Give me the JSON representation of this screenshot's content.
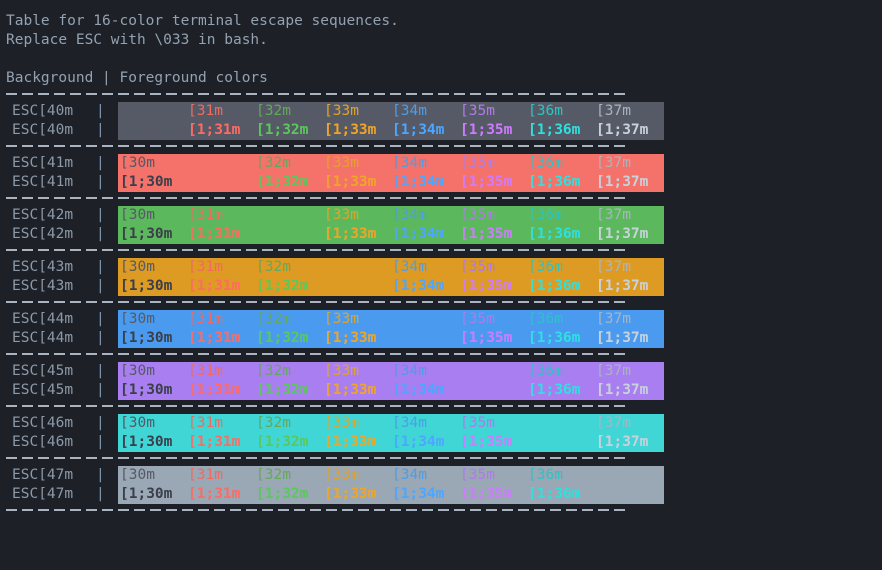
{
  "terminal": {
    "background_color": "#1d2127",
    "default_text_color": "#93a1b0",
    "separator_color": "#aab4c0",
    "pipe_color": "#7f93ad"
  },
  "header": {
    "line1": "Table for 16-color terminal escape sequences.",
    "line2": "Replace ESC with \\033 in bash.",
    "section_title": "Background | Foreground colors",
    "pipe": "|"
  },
  "foreground_codes": {
    "normal": [
      "[30m",
      "[31m",
      "[32m",
      "[33m",
      "[34m",
      "[35m",
      "[36m",
      "[37m"
    ],
    "bold": [
      "[1;30m",
      "[1;31m",
      "[1;32m",
      "[1;33m",
      "[1;34m",
      "[1;35m",
      "[1;36m",
      "[1;37m"
    ]
  },
  "foreground_colors": {
    "normal": [
      "#555a66",
      "#f06a60",
      "#64a85a",
      "#e0a32a",
      "#4d9de8",
      "#b07ae8",
      "#2dc3c3",
      "#a9b4c0"
    ],
    "bold": [
      "#3a3f4a",
      "#ff6b63",
      "#5bc85b",
      "#f0a526",
      "#4da6ff",
      "#cf7bff",
      "#2ee0e0",
      "#c8d2dc"
    ]
  },
  "rows": [
    {
      "label": "ESC[40m",
      "bg_code": "40",
      "bg_name": "black",
      "bg_color": "#555a66",
      "hidden_index": 0
    },
    {
      "label": "ESC[41m",
      "bg_code": "41",
      "bg_name": "red",
      "bg_color": "#f4726a",
      "hidden_index": 1
    },
    {
      "label": "ESC[42m",
      "bg_code": "42",
      "bg_name": "green",
      "bg_color": "#5cb85c",
      "hidden_index": 2
    },
    {
      "label": "ESC[43m",
      "bg_code": "43",
      "bg_name": "yellow",
      "bg_color": "#dd9b23",
      "hidden_index": 3
    },
    {
      "label": "ESC[44m",
      "bg_code": "44",
      "bg_name": "blue",
      "bg_color": "#4a9bf0",
      "hidden_index": 4
    },
    {
      "label": "ESC[45m",
      "bg_code": "45",
      "bg_name": "magenta",
      "bg_color": "#a97ef0",
      "hidden_index": 5
    },
    {
      "label": "ESC[46m",
      "bg_code": "46",
      "bg_name": "cyan",
      "bg_color": "#40d6d6",
      "hidden_index": 6
    },
    {
      "label": "ESC[47m",
      "bg_code": "47",
      "bg_name": "white",
      "bg_color": "#9aa7b5",
      "hidden_index": 7
    }
  ],
  "layout": {
    "cell_widths_normal": [
      68,
      68,
      68,
      68,
      68,
      68,
      68,
      68
    ],
    "cell_widths_bold": [
      68,
      68,
      68,
      68,
      68,
      68,
      68,
      68
    ]
  }
}
